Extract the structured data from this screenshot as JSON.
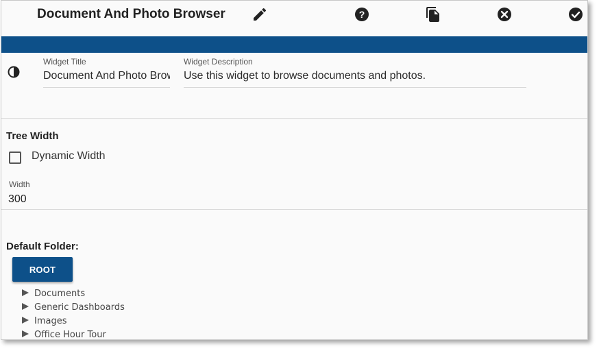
{
  "header": {
    "title": "Document And Photo Browser",
    "icons": [
      "edit-icon",
      "help-icon",
      "copy-icon",
      "close-icon",
      "confirm-icon"
    ]
  },
  "colors": {
    "accent": "#0d5089",
    "background": "#fafafa"
  },
  "widget": {
    "title_label": "Widget Title",
    "title_value": "Document And Photo Browser",
    "description_label": "Widget Description",
    "description_value": "Use this widget to browse documents and photos."
  },
  "tree_width": {
    "heading": "Tree Width",
    "dynamic_label": "Dynamic Width",
    "dynamic_checked": false,
    "width_label": "Width",
    "width_value": "300"
  },
  "default_folder": {
    "heading": "Default Folder:",
    "root_button": "ROOT",
    "items": [
      "Documents",
      "Generic Dashboards",
      "Images",
      "Office Hour Tour"
    ]
  }
}
